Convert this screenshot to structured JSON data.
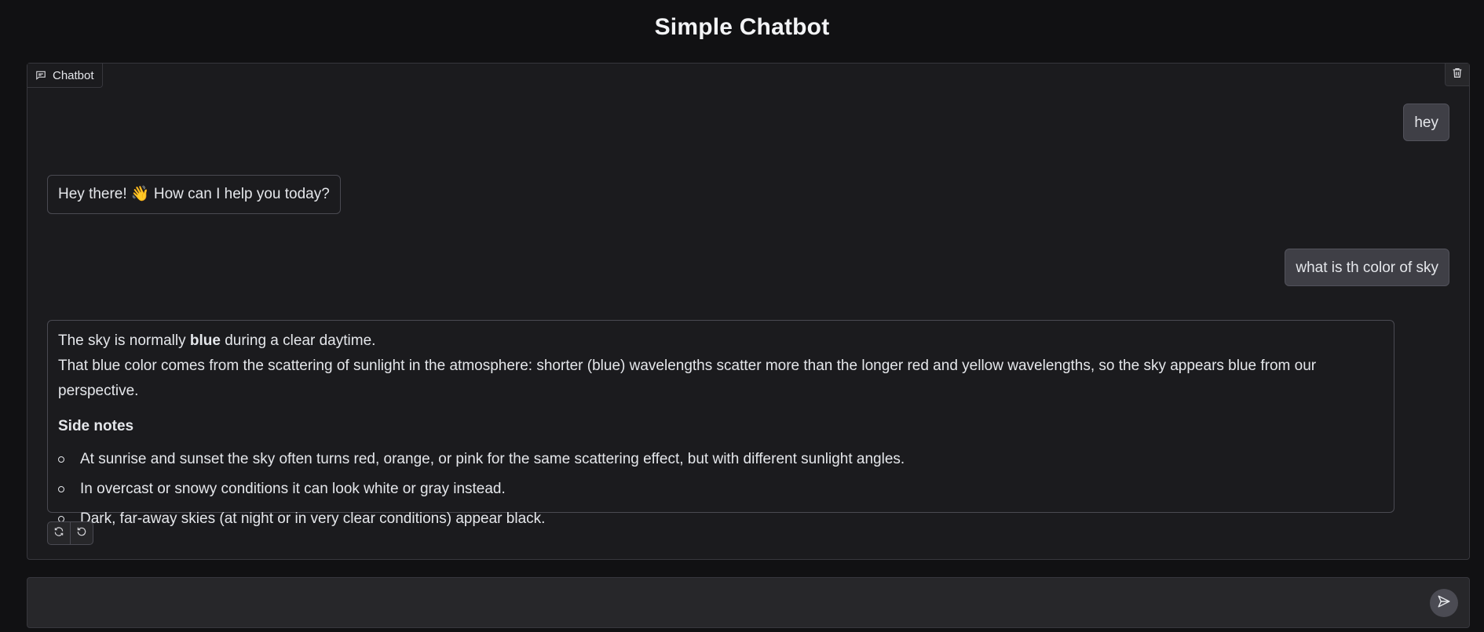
{
  "page": {
    "title": "Simple Chatbot"
  },
  "chat": {
    "label": "Chatbot",
    "messages": [
      {
        "role": "user",
        "text": "hey"
      },
      {
        "role": "assistant",
        "text": "Hey there! 👋 How can I help you today?"
      },
      {
        "role": "user",
        "text": "what is th color of sky"
      },
      {
        "role": "assistant",
        "line1_before": "The sky is normally ",
        "line1_bold": "blue",
        "line1_after": " during a clear daytime.",
        "line2": "That blue color comes from the scattering of sunlight in the atmosphere: shorter (blue) wavelengths scatter more than the longer red and yellow wavelengths, so the sky appears blue from our perspective.",
        "notes_title": "Side notes",
        "notes": [
          "At sunrise and sunset the sky often turns red, orange, or pink for the same scattering effect, but with different sunlight angles.",
          "In overcast or snowy conditions it can look white or gray instead.",
          "Dark, far-away skies (at night or in very clear conditions) appear black."
        ]
      }
    ]
  },
  "input": {
    "value": "",
    "placeholder": ""
  },
  "icons": {
    "chat": "chat-bubble-icon",
    "clear": "trash-icon",
    "retry": "refresh-icon",
    "undo": "undo-icon",
    "send": "send-icon"
  },
  "colors": {
    "background": "#111113",
    "panel": "#1b1b1e",
    "user_bubble": "#3f3f46",
    "input_bar": "#27272a"
  }
}
